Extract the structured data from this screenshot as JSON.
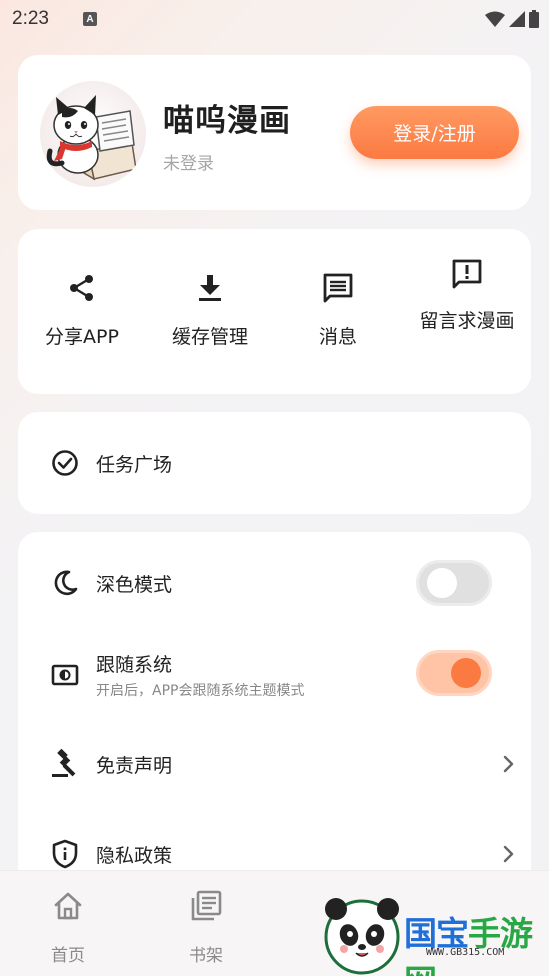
{
  "status_bar": {
    "time": "2:23",
    "notification_icon": "A"
  },
  "profile": {
    "app_title": "喵呜漫画",
    "login_status": "未登录",
    "login_button": "登录/注册",
    "avatar_icon": "cat-reading-icon"
  },
  "quick_actions": [
    {
      "label": "分享APP",
      "icon": "share-icon"
    },
    {
      "label": "缓存管理",
      "icon": "download-icon"
    },
    {
      "label": "消息",
      "icon": "message-icon"
    },
    {
      "label": "留言求漫画",
      "icon": "feedback-icon"
    }
  ],
  "task": {
    "label": "任务广场",
    "icon": "check-circle-icon"
  },
  "settings": {
    "dark_mode": {
      "label": "深色模式",
      "icon": "moon-icon",
      "enabled": false
    },
    "follow_system": {
      "label": "跟随系统",
      "subtitle": "开启后，APP会跟随系统主题模式",
      "icon": "theme-icon",
      "enabled": true
    },
    "disclaimer": {
      "label": "免责声明",
      "icon": "gavel-icon"
    },
    "privacy": {
      "label": "隐私政策",
      "icon": "shield-info-icon"
    }
  },
  "bottom_nav": [
    {
      "label": "首页",
      "icon": "home-icon"
    },
    {
      "label": "书架",
      "icon": "bookshelf-icon"
    }
  ],
  "watermark": {
    "text_1": "国宝",
    "text_2": "手游网",
    "url": "WWW.GB315.COM"
  },
  "colors": {
    "accent": "#fb7a42",
    "accent_light": "#ffc4a6",
    "watermark_blue": "#1f6fd8",
    "watermark_green": "#28a745"
  }
}
